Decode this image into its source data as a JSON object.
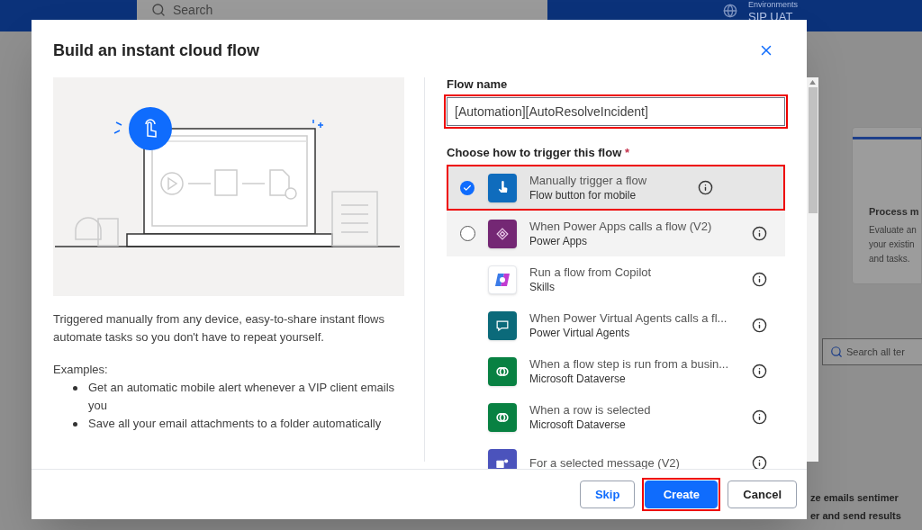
{
  "background": {
    "search_placeholder": "Search",
    "environment_label": "Environments",
    "environment_name": "SIP UAT",
    "card_title": "Process m",
    "card_text": "Evaluate an\nyour existin\nand tasks.",
    "template_search_placeholder": "Search all ter",
    "template_title": "ze emails sentimer\ner and send results"
  },
  "dialog": {
    "title": "Build an instant cloud flow",
    "description": "Triggered manually from any device, easy-to-share instant flows automate tasks so you don't have to repeat yourself.",
    "examples_label": "Examples:",
    "examples": [
      "Get an automatic mobile alert whenever a VIP client emails you",
      "Save all your email attachments to a folder automatically"
    ],
    "flow_name": {
      "label": "Flow name",
      "value": "[Automation][AutoResolveIncident]",
      "highlighted": true
    },
    "trigger_label": "Choose how to trigger this flow",
    "required_mark": "*",
    "triggers": [
      {
        "kind": "radio",
        "color": "#0f6cbd",
        "title": "Manually trigger a flow",
        "subtitle": "Flow button for mobile",
        "selected": true,
        "highlighted": true
      },
      {
        "kind": "radio",
        "color": "#742774",
        "title": "When Power Apps calls a flow (V2)",
        "subtitle": "Power Apps",
        "selected": false,
        "highlighted": false
      },
      {
        "kind": "plain",
        "color": "#ffffff",
        "title": "Run a flow from Copilot",
        "subtitle": "Skills",
        "selected": false,
        "highlighted": false
      },
      {
        "kind": "plain",
        "color": "#0b6a7a",
        "title": "When Power Virtual Agents calls a fl...",
        "subtitle": "Power Virtual Agents",
        "selected": false,
        "highlighted": false
      },
      {
        "kind": "plain",
        "color": "#088142",
        "title": "When a flow step is run from a busin...",
        "subtitle": "Microsoft Dataverse",
        "selected": false,
        "highlighted": false
      },
      {
        "kind": "plain",
        "color": "#088142",
        "title": "When a row is selected",
        "subtitle": "Microsoft Dataverse",
        "selected": false,
        "highlighted": false
      },
      {
        "kind": "plain",
        "color": "#4b53bc",
        "title": "For a selected message (V2)",
        "selected": false,
        "highlighted": false
      }
    ],
    "buttons": [
      {
        "kind": "secondary-link",
        "label": "Skip",
        "highlighted": false
      },
      {
        "kind": "primary",
        "label": "Create",
        "highlighted": true
      },
      {
        "kind": "secondary",
        "label": "Cancel",
        "highlighted": false
      }
    ]
  }
}
